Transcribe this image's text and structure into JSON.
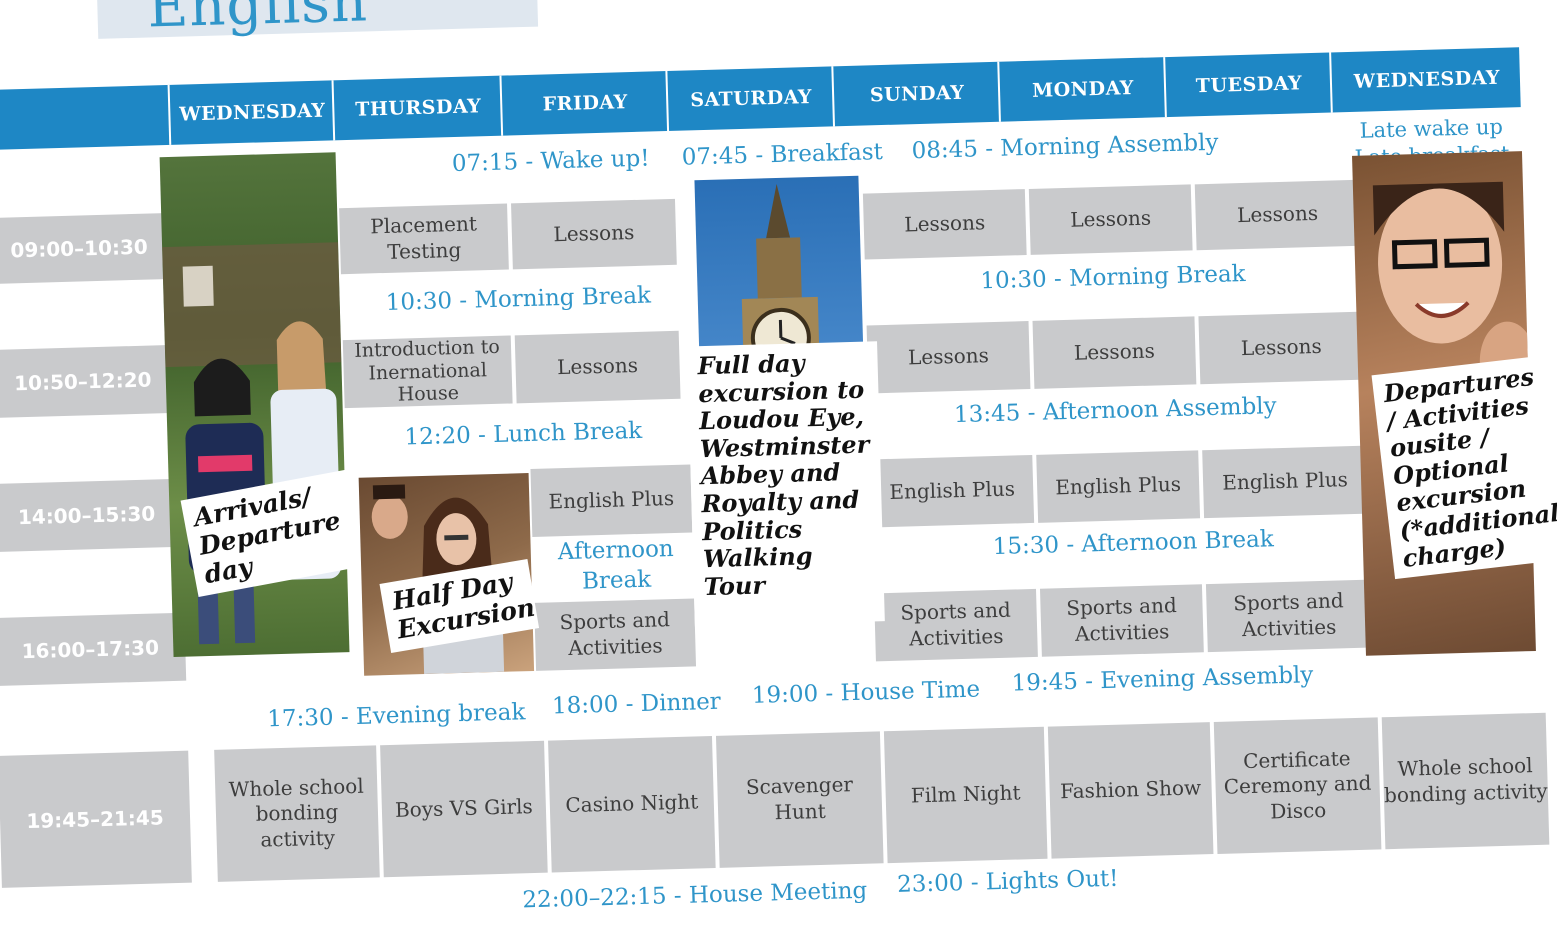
{
  "title": "English",
  "days": [
    "WEDNESDAY",
    "THURSDAY",
    "FRIDAY",
    "SATURDAY",
    "SUNDAY",
    "MONDAY",
    "TUESDAY",
    "WEDNESDAY"
  ],
  "times": [
    "09:00–10:30",
    "10:50–12:20",
    "14:00–15:30",
    "16:00–17:30",
    "19:45–21:45"
  ],
  "last_day_top": [
    "Late wake up",
    "Late breakfast"
  ],
  "morning": {
    "wake": "07:15 - Wake up!",
    "breakfast": "07:45 - Breakfast",
    "assembly": "08:45 - Morning Assembly"
  },
  "slot1": {
    "thu": "Placement Testing",
    "fri": "Lessons",
    "sun": "Lessons",
    "mon": "Lessons",
    "tue": "Lessons"
  },
  "morning_break": "10:30 - Morning Break",
  "slot2": {
    "thu": "Introduction to Inernational House",
    "fri": "Lessons",
    "sun": "Lessons",
    "mon": "Lessons",
    "tue": "Lessons"
  },
  "lunch_break": "12:20 - Lunch Break",
  "afternoon_assembly": "13:45 - Afternoon Assembly",
  "slot3": {
    "fri": "English Plus",
    "sun": "English Plus",
    "mon": "English Plus",
    "tue": "English Plus"
  },
  "afternoon_break_short": "Afternoon Break",
  "afternoon_break": "15:30 - Afternoon Break",
  "slot4": {
    "fri": "Sports and Activities",
    "sun": "Sports and Activities",
    "mon": "Sports and Activities",
    "tue": "Sports and Activities"
  },
  "notes": {
    "arrivals": "Arrivals/ Departure day",
    "halfday": "Half Day Excursion",
    "fullday": "Full day excursion to Loudou Eye, Westminster Abbey and Royalty and Politics Walking Tour",
    "departures": "Departures / Activities ousite / Optional excursion (*additional charge)"
  },
  "evening": {
    "break": "17:30 - Evening break",
    "dinner": "18:00 - Dinner",
    "house": "19:00 - House Time",
    "assembly": "19:45 - Evening Assembly"
  },
  "slot5": [
    "Whole school bonding activity",
    "Boys VS Girls",
    "Casino Night",
    "Scavenger Hunt",
    "Film Night",
    "Fashion Show",
    "Certificate Ceremony and Disco",
    "Whole school bonding activity"
  ],
  "night": {
    "meeting": "22:00–22:15 - House Meeting",
    "lights": "23:00 - Lights Out!"
  },
  "colors": {
    "header_blue": "#1e87c5",
    "text_blue": "#2f95c9",
    "cell_grey": "#c9cacc"
  }
}
